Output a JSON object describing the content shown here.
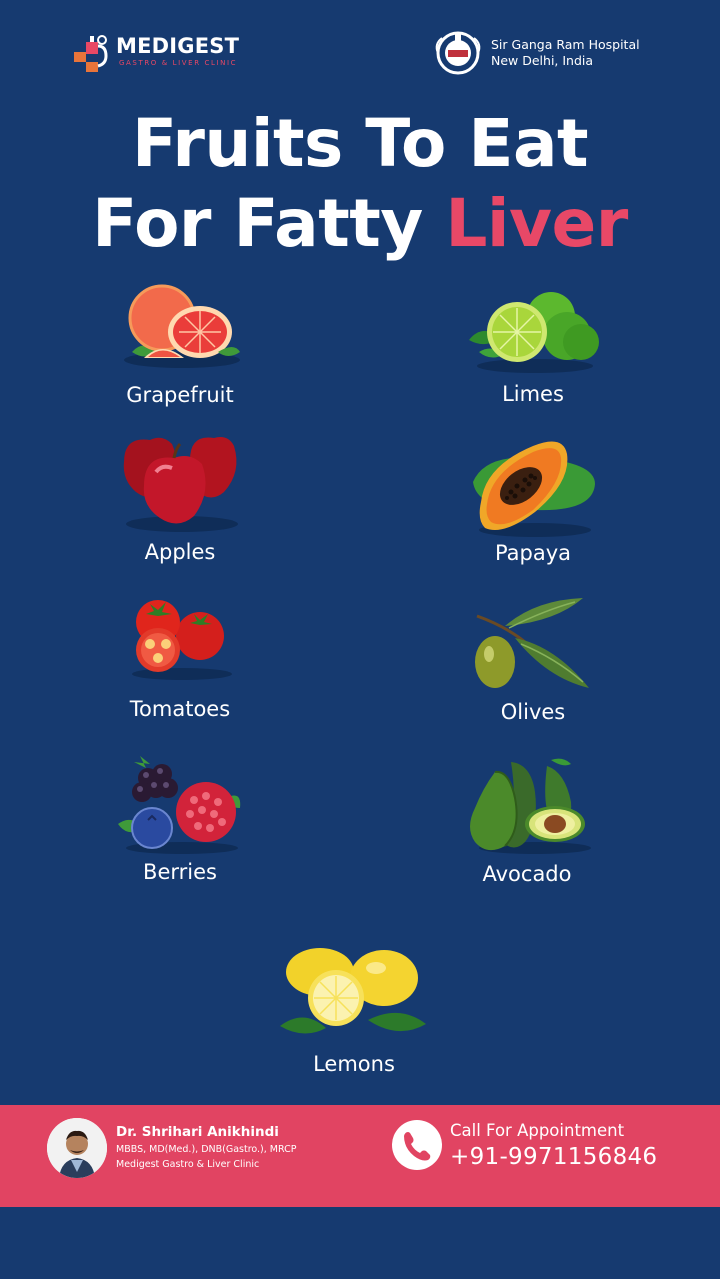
{
  "header": {
    "brand_name": "MEDIGEST",
    "brand_tagline": "GASTRO & LIVER CLINIC",
    "hospital_line1": "Sir Ganga Ram Hospital",
    "hospital_line2": "New Delhi, India"
  },
  "title": {
    "line1": "Fruits To Eat",
    "line2_prefix": "For Fatty ",
    "line2_accent": "Liver"
  },
  "fruits": [
    {
      "label": "Grapefruit",
      "icon": "grapefruit-icon"
    },
    {
      "label": "Limes",
      "icon": "lime-icon"
    },
    {
      "label": "Apples",
      "icon": "apple-icon"
    },
    {
      "label": "Papaya",
      "icon": "papaya-icon"
    },
    {
      "label": "Tomatoes",
      "icon": "tomato-icon"
    },
    {
      "label": "Olives",
      "icon": "olive-icon"
    },
    {
      "label": "Berries",
      "icon": "berries-icon"
    },
    {
      "label": "Avocado",
      "icon": "avocado-icon"
    },
    {
      "label": "Lemons",
      "icon": "lemon-icon"
    }
  ],
  "footer": {
    "doctor_name": "Dr. Shrihari Anikhindi",
    "doctor_quals": "MBBS, MD(Med.), DNB(Gastro.), MRCP",
    "doctor_clinic": "Medigest Gastro & Liver Clinic",
    "call_label": "Call For Appointment",
    "call_number": "+91-9971156846"
  },
  "colors": {
    "background": "#163a70",
    "accent": "#e84867",
    "footer_band": "#e14462"
  }
}
